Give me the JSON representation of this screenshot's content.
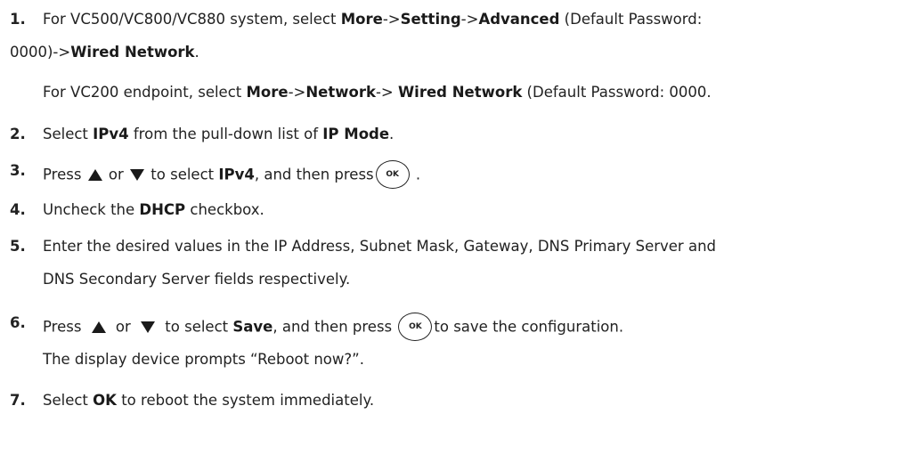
{
  "steps": [
    {
      "num": "1.",
      "line1": {
        "t1": "For VC500/VC800/VC880 system, select ",
        "b1": "More",
        "t2": "->",
        "b2": "Setting",
        "t3": "->",
        "b3": "Advanced",
        "t4": " (Default Password:"
      },
      "line2": {
        "t1": "0000)->",
        "b1": "Wired Network",
        "t2": "."
      },
      "line3": {
        "t1": "For VC200 endpoint, select ",
        "b1": "More",
        "t2": "->",
        "b2": "Network",
        "t3": "-> ",
        "b3": "Wired Network",
        "t4": " (Default Password: 0000."
      }
    },
    {
      "num": "2.",
      "t1": "Select ",
      "b1": "IPv4",
      "t2": " from the pull-down list of ",
      "b2": "IP Mode",
      "t3": "."
    },
    {
      "num": "3.",
      "t1": "Press ",
      "t2": " or ",
      "t3": " to select ",
      "b1": "IPv4",
      "t4": ", and then press",
      "t5": " ."
    },
    {
      "num": "4.",
      "t1": "Uncheck the ",
      "b1": "DHCP",
      "t2": " checkbox."
    },
    {
      "num": "5.",
      "line1": "Enter the desired values in the IP Address, Subnet Mask, Gateway, DNS Primary Server and",
      "line2": "DNS Secondary Server fields respectively."
    },
    {
      "num": "6.",
      "t1": "Press ",
      "t2": " or ",
      "t3": " to select ",
      "b1": "Save",
      "t4": ", and then press ",
      "t5": "to save the configuration.",
      "line2": "The display device prompts “Reboot now?”."
    },
    {
      "num": "7.",
      "t1": "Select ",
      "b1": "OK",
      "t2": " to reboot the system immediately."
    }
  ],
  "ok_key": {
    "label": "OK"
  },
  "icons": {
    "up": "triangle-up-icon",
    "down": "triangle-down-icon"
  }
}
